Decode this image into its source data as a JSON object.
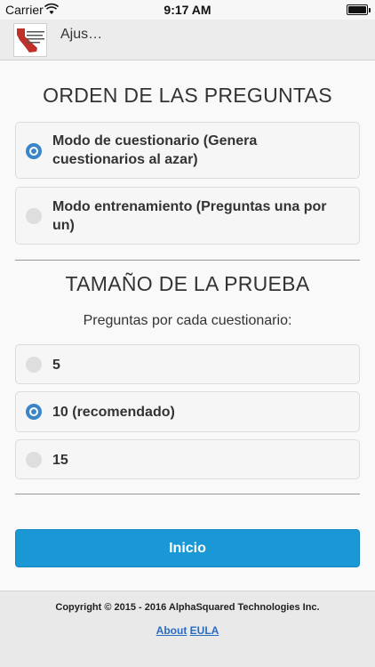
{
  "status_bar": {
    "carrier": "Carrier",
    "time": "9:17 AM",
    "battery_level": 1.0
  },
  "header": {
    "title": "Ajus…"
  },
  "order_section": {
    "title": "ORDEN DE LAS PREGUNTAS",
    "options": [
      {
        "label": "Modo de cuestionario (Genera cuestionarios al azar)",
        "selected": true
      },
      {
        "label": "Modo entrenamiento (Preguntas una por un)",
        "selected": false
      }
    ]
  },
  "size_section": {
    "title": "TAMAÑO DE LA PRUEBA",
    "subtitle": "Preguntas por cada cuestionario:",
    "options": [
      {
        "label": "5",
        "selected": false
      },
      {
        "label": "10 (recomendado)",
        "selected": true
      },
      {
        "label": "15",
        "selected": false
      }
    ]
  },
  "start_button": {
    "label": "Inicio"
  },
  "footer": {
    "copyright": "Copyright © 2015 - 2016 AlphaSquared Technologies Inc.",
    "about_link": "About",
    "eula_link": "EULA"
  },
  "colors": {
    "accent": "#1a98d5",
    "radio_selected": "#3a86c8",
    "link": "#2a6cc0"
  }
}
